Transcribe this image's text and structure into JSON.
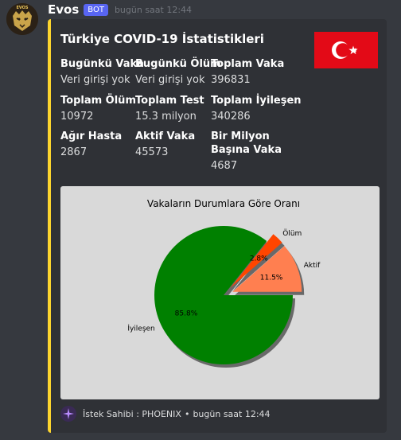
{
  "message": {
    "author": "Evos",
    "bot_tag": "BOT",
    "timestamp": "bugün saat 12:44",
    "avatar_text": "EVOS"
  },
  "embed": {
    "accent_color": "#fcd52e",
    "title": "Türkiye COVID-19 İstatistikleri",
    "thumbnail": "turkish-flag",
    "fields": [
      {
        "name": "Bugünkü Vaka",
        "value": "Veri girişi yok"
      },
      {
        "name": "Bugünkü Ölüm",
        "value": "Veri girişi yok"
      },
      {
        "name": "Toplam Vaka",
        "value": "396831"
      },
      {
        "name": "Toplam Ölüm",
        "value": "10972"
      },
      {
        "name": "Toplam Test",
        "value": "15.3 milyon"
      },
      {
        "name": "Toplam İyileşen",
        "value": "340286"
      },
      {
        "name": "Ağır Hasta",
        "value": "2867"
      },
      {
        "name": "Aktif Vaka",
        "value": "45573"
      },
      {
        "name": "Bir Milyon Başına Vaka",
        "value": "4687"
      }
    ],
    "footer": {
      "requester": "İstek Sahibi : PHOENIX",
      "separator": "•",
      "time": "bugün saat 12:44"
    }
  },
  "chart_data": {
    "type": "pie",
    "title": "Vakaların Durumlara Göre Oranı",
    "categories": [
      "Aktif",
      "Ölüm",
      "İyileşen"
    ],
    "values": [
      11.5,
      2.8,
      85.8
    ],
    "value_labels": [
      "11.5%",
      "2.8%",
      "85.8%"
    ],
    "colors": [
      "#ff7f50",
      "#ff4500",
      "#008000"
    ],
    "exploded": [
      true,
      true,
      false
    ],
    "shadow": true,
    "background": "#d9d9d9"
  }
}
